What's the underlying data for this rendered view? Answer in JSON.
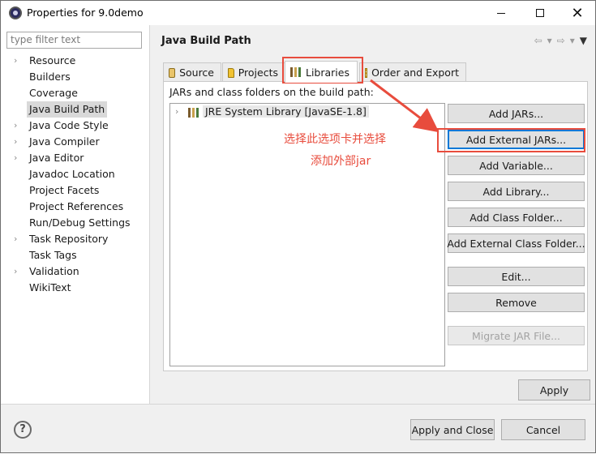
{
  "window": {
    "title": "Properties for 9.0demo",
    "minimize_label": "—",
    "close_label": "✕"
  },
  "sidebar": {
    "filter_placeholder": "type filter text",
    "items": [
      {
        "label": "Resource",
        "expandable": true
      },
      {
        "label": "Builders",
        "expandable": false
      },
      {
        "label": "Coverage",
        "expandable": false
      },
      {
        "label": "Java Build Path",
        "expandable": false,
        "selected": true
      },
      {
        "label": "Java Code Style",
        "expandable": true
      },
      {
        "label": "Java Compiler",
        "expandable": true
      },
      {
        "label": "Java Editor",
        "expandable": true
      },
      {
        "label": "Javadoc Location",
        "expandable": false
      },
      {
        "label": "Project Facets",
        "expandable": false
      },
      {
        "label": "Project References",
        "expandable": false
      },
      {
        "label": "Run/Debug Settings",
        "expandable": false
      },
      {
        "label": "Task Repository",
        "expandable": true
      },
      {
        "label": "Task Tags",
        "expandable": false
      },
      {
        "label": "Validation",
        "expandable": true
      },
      {
        "label": "WikiText",
        "expandable": false
      }
    ]
  },
  "main": {
    "page_title": "Java Build Path",
    "tabs": [
      {
        "label": "Source",
        "icon": "source-folder-icon"
      },
      {
        "label": "Projects",
        "icon": "project-folder-icon"
      },
      {
        "label": "Libraries",
        "icon": "libraries-icon",
        "active": true
      },
      {
        "label": "Order and Export",
        "icon": "order-export-icon"
      }
    ],
    "build_path_label": "JARs and class folders on the build path:",
    "libraries": [
      {
        "label": "JRE System Library [JavaSE-1.8]"
      }
    ],
    "buttons": {
      "add_jars": "Add JARs...",
      "add_external_jars": "Add External JARs...",
      "add_variable": "Add Variable...",
      "add_library": "Add Library...",
      "add_class_folder": "Add Class Folder...",
      "add_external_class_folder": "Add External Class Folder...",
      "edit": "Edit...",
      "remove": "Remove",
      "migrate_jar": "Migrate JAR File..."
    },
    "apply": "Apply"
  },
  "annotation": {
    "line1": "选择此选项卡并选择",
    "line2": "添加外部jar",
    "color": "#e84c3d"
  },
  "footer": {
    "help": "?",
    "apply_and_close": "Apply and Close",
    "cancel": "Cancel"
  }
}
